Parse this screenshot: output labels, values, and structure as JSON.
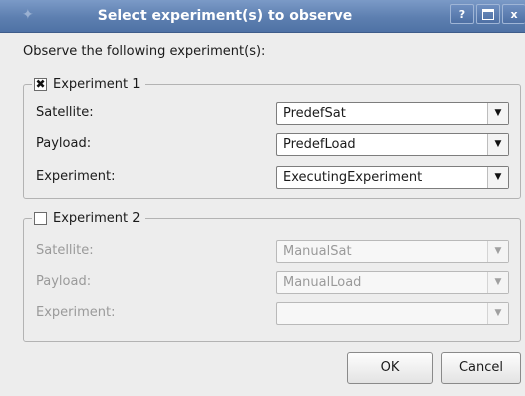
{
  "window": {
    "title": "Select experiment(s) to observe",
    "buttons": {
      "help": "?",
      "close": "x"
    }
  },
  "intro_text": "Observe the following experiment(s):",
  "experiment1": {
    "label": "Experiment 1",
    "checked": true,
    "check_mark": "✖",
    "satellite_label": "Satellite:",
    "satellite_value": "PredefSat",
    "payload_label": "Payload:",
    "payload_value": "PredefLoad",
    "experiment_label": "Experiment:",
    "experiment_value": "ExecutingExperiment"
  },
  "experiment2": {
    "label": "Experiment 2",
    "checked": false,
    "satellite_label": "Satellite:",
    "satellite_value": "ManualSat",
    "payload_label": "Payload:",
    "payload_value": "ManualLoad",
    "experiment_label": "Experiment:",
    "experiment_value": ""
  },
  "dropdown_arrow": "▼",
  "dialog_buttons": {
    "ok": "OK",
    "cancel": "Cancel"
  },
  "icons": {
    "app": "app-icon",
    "help": "help-icon",
    "maximize": "maximize-icon",
    "close": "close-icon",
    "dropdown": "chevron-down-icon"
  },
  "colors": {
    "titlebar": "#5d7fb0",
    "dialog_background": "#ededed",
    "disabled_text": "#9a9a9a"
  }
}
